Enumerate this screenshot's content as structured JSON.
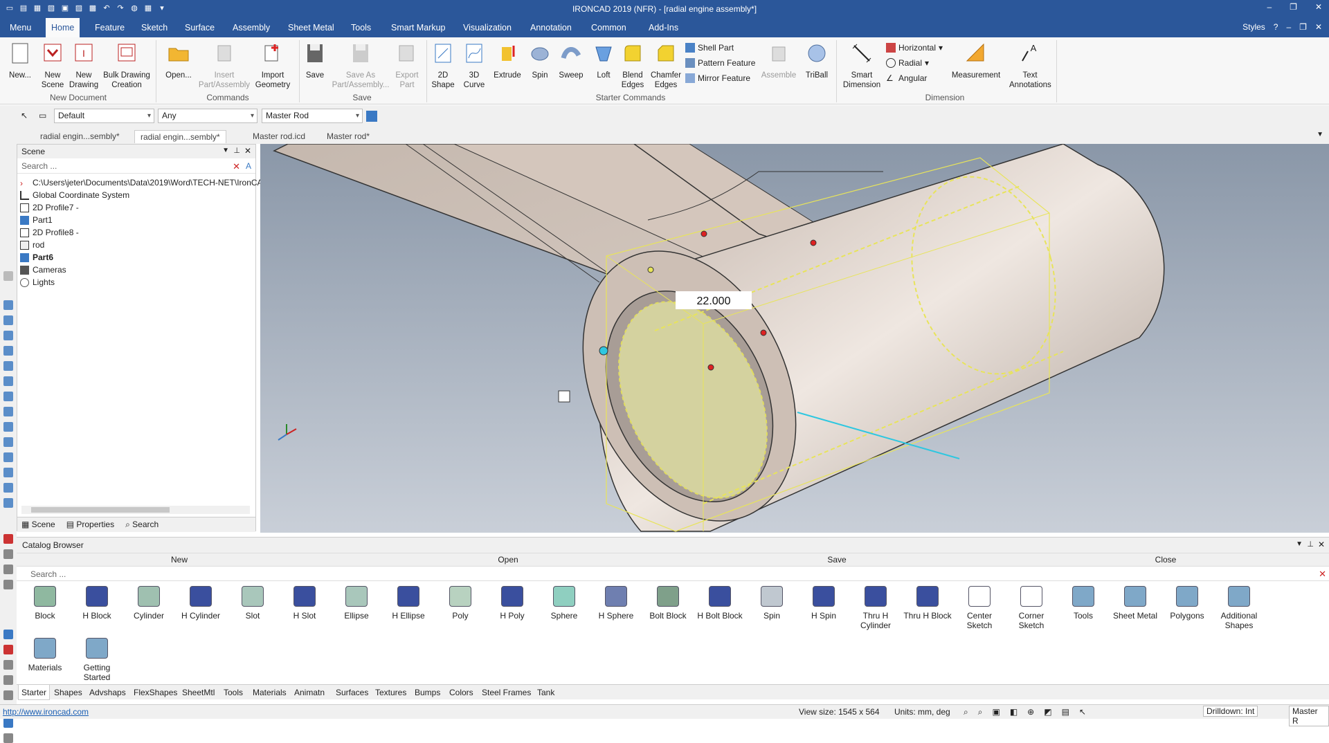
{
  "window": {
    "title": "IRONCAD 2019 (NFR) - [radial engine assembly*]",
    "minimize": "–",
    "restore": "❐",
    "close": "✕"
  },
  "menubar": {
    "tabs": [
      "Menu",
      "Home",
      "Feature",
      "Sketch",
      "Surface",
      "Assembly",
      "Sheet Metal",
      "Tools",
      "Smart Markup",
      "Visualization",
      "Annotation",
      "Common",
      "Add-Ins"
    ],
    "active": "Home",
    "styles": "Styles"
  },
  "ribbon": {
    "new_document": {
      "label": "New Document",
      "buttons": [
        "New...",
        "New Scene",
        "New Drawing",
        "Bulk Drawing Creation"
      ]
    },
    "commands": {
      "label": "Commands",
      "buttons": [
        "Open...",
        "Insert Part/Assembly",
        "Import Geometry"
      ]
    },
    "save": {
      "label": "Save",
      "buttons": [
        "Save",
        "Save As Part/Assembly...",
        "Export Part"
      ]
    },
    "starter": {
      "label": "Starter Commands",
      "buttons": [
        "2D Shape",
        "3D Curve",
        "Extrude",
        "Spin",
        "Sweep",
        "Loft",
        "Blend Edges",
        "Chamfer Edges"
      ],
      "small": [
        "Shell Part",
        "Pattern Feature",
        "Mirror Feature"
      ],
      "assemble": "Assemble",
      "triball": "TriBall"
    },
    "dimension": {
      "label": "Dimension",
      "smart": "Smart Dimension",
      "small": [
        "Horizontal",
        "Radial",
        "Angular"
      ],
      "measurement": "Measurement",
      "text": "Text Annotations"
    }
  },
  "toolbar": {
    "style_value": "Default",
    "filter_value": "Any",
    "part_value": "Master Rod"
  },
  "doc_tabs": [
    "radial engin...sembly*",
    "radial engin...sembly*",
    "Master rod.icd",
    "Master rod*"
  ],
  "doc_tab_active": 1,
  "scene": {
    "title": "Scene",
    "search_placeholder": "Search ...",
    "items": [
      {
        "label": "C:\\Users\\jeter\\Documents\\Data\\2019\\Word\\TECH-NET\\IronCA",
        "bold": false
      },
      {
        "label": "Global Coordinate System",
        "bold": false
      },
      {
        "label": "2D Profile7 -",
        "bold": false
      },
      {
        "label": "Part1",
        "bold": false
      },
      {
        "label": "2D Profile8 -",
        "bold": false
      },
      {
        "label": "rod",
        "bold": false
      },
      {
        "label": "Part6",
        "bold": true
      },
      {
        "label": "Cameras",
        "bold": false
      },
      {
        "label": "Lights",
        "bold": false
      }
    ],
    "bottom_tabs": [
      "Scene",
      "Properties",
      "Search"
    ]
  },
  "viewport": {
    "dimension_value": "22.000",
    "colors": {
      "bg_top": "#8a97a8",
      "bg_bottom": "#c9cfd8",
      "part": "#d8cbc2",
      "sketch": "#e8e45a"
    }
  },
  "catalog": {
    "title": "Catalog Browser",
    "actions": [
      "New",
      "Open",
      "Save",
      "Close"
    ],
    "search_placeholder": "Search ...",
    "items": [
      "Block",
      "H Block",
      "Cylinder",
      "H Cylinder",
      "Slot",
      "H Slot",
      "Ellipse",
      "H Ellipse",
      "Poly",
      "H Poly",
      "Sphere",
      "H Sphere",
      "Bolt Block",
      "H Bolt Block",
      "Spin",
      "H Spin",
      "Thru H Cylinder",
      "Thru H Block",
      "Center Sketch",
      "Corner Sketch",
      "Tools",
      "Sheet Metal",
      "Polygons",
      "Additional Shapes",
      "Materials",
      "Getting Started"
    ],
    "tabs": [
      "Starter",
      "Shapes",
      "Advshaps",
      "FlexShapes",
      "SheetMtl",
      "Tools",
      "Materials",
      "Animatn",
      "Surfaces",
      "Textures",
      "Bumps",
      "Colors",
      "Steel Frames",
      "Tank"
    ]
  },
  "status": {
    "url": "http://www.ironcad.com",
    "view_size": "View size: 1545 x 564",
    "units": "Units: mm, deg",
    "drilldown": "Drilldown: Int",
    "part": "Master R"
  }
}
